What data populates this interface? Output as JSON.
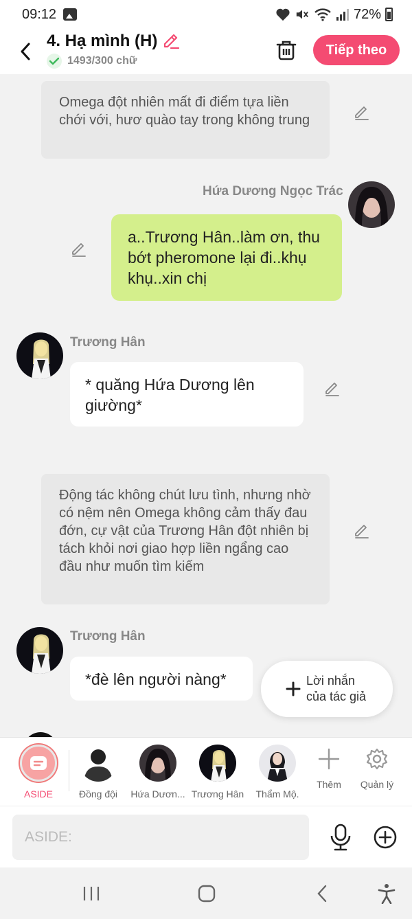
{
  "status_bar": {
    "time": "09:12",
    "battery": "72%"
  },
  "header": {
    "title": "4. Hạ mình (H)",
    "word_count": "1493/300 chữ",
    "next_label": "Tiếp theo"
  },
  "messages": [
    {
      "type": "narration",
      "text": "Omega đột nhiên mất đi điểm tựa liền chới với, hươ quào tay trong không trung"
    },
    {
      "type": "user",
      "name": "Hứa Dương Ngọc Trác",
      "text": "a..Trương Hân..làm ơn, thu bớt pheromone lại đi..khụ khụ..xin chị"
    },
    {
      "type": "character",
      "name": "Trương Hân",
      "text": "* quăng Hứa Dương lên giường*"
    },
    {
      "type": "narration",
      "text": "Động tác không chút lưu tình, nhưng nhờ có nệm nên Omega không cảm thấy đau đớn, cự vật của Trương Hân đột nhiên bị tách khỏi nơi giao hợp liền ngẩng cao đầu như muốn tìm kiếm"
    },
    {
      "type": "character",
      "name": "Trương Hân",
      "text": "*đè lên người nàng*"
    }
  ],
  "author_note": {
    "label": "Lời nhắn của tác giả"
  },
  "characters": [
    {
      "label": "ASIDE"
    },
    {
      "label": "Đồng đội"
    },
    {
      "label": "Hứa Dươn..."
    },
    {
      "label": "Trương Hân"
    },
    {
      "label": "Thẩm Mộ."
    },
    {
      "label": "Thêm"
    },
    {
      "label": "Quản lý"
    }
  ],
  "input": {
    "placeholder": "ASIDE:"
  },
  "colors": {
    "accent": "#f44b72",
    "user_bubble": "#d4ef8c",
    "narration_bg": "#e8e8e8"
  }
}
